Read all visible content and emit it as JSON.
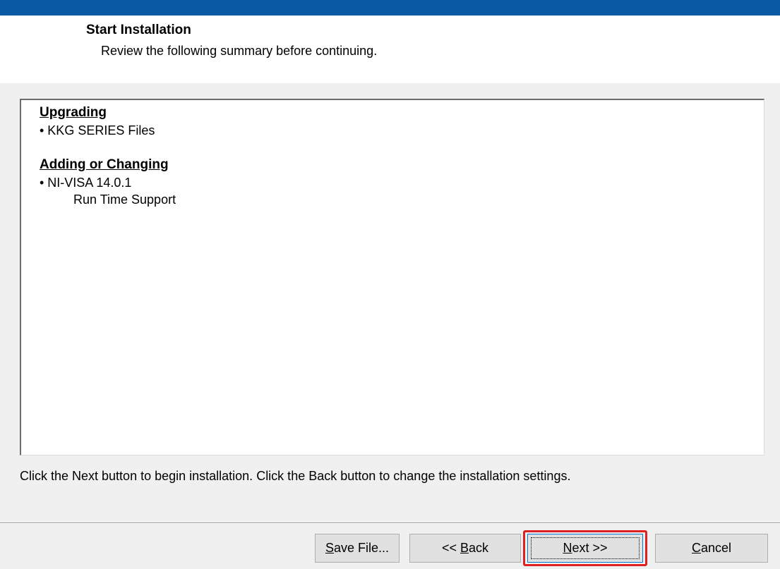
{
  "header": {
    "title": "Start Installation",
    "subtitle": "Review the following summary before continuing."
  },
  "summary": {
    "sections": [
      {
        "heading": "Upgrading",
        "items": [
          "• KKG SERIES Files"
        ]
      },
      {
        "heading": "Adding or Changing",
        "items": [
          "• NI-VISA 14.0.1"
        ],
        "subitems": [
          "Run Time Support"
        ]
      }
    ]
  },
  "instruction": "Click the Next button to begin installation.  Click the Back button to change the installation settings.",
  "buttons": {
    "save": {
      "mnemonic": "S",
      "rest": "ave File..."
    },
    "back": {
      "before": "<< ",
      "mnemonic": "B",
      "rest": "ack"
    },
    "next": {
      "mnemonic": "N",
      "rest": "ext >>"
    },
    "cancel": {
      "mnemonic": "C",
      "rest": "ancel"
    }
  },
  "colors": {
    "title_strip": "#0a5aa5",
    "focus_highlight": "#e02020",
    "button_face": "#e1e1e1"
  }
}
